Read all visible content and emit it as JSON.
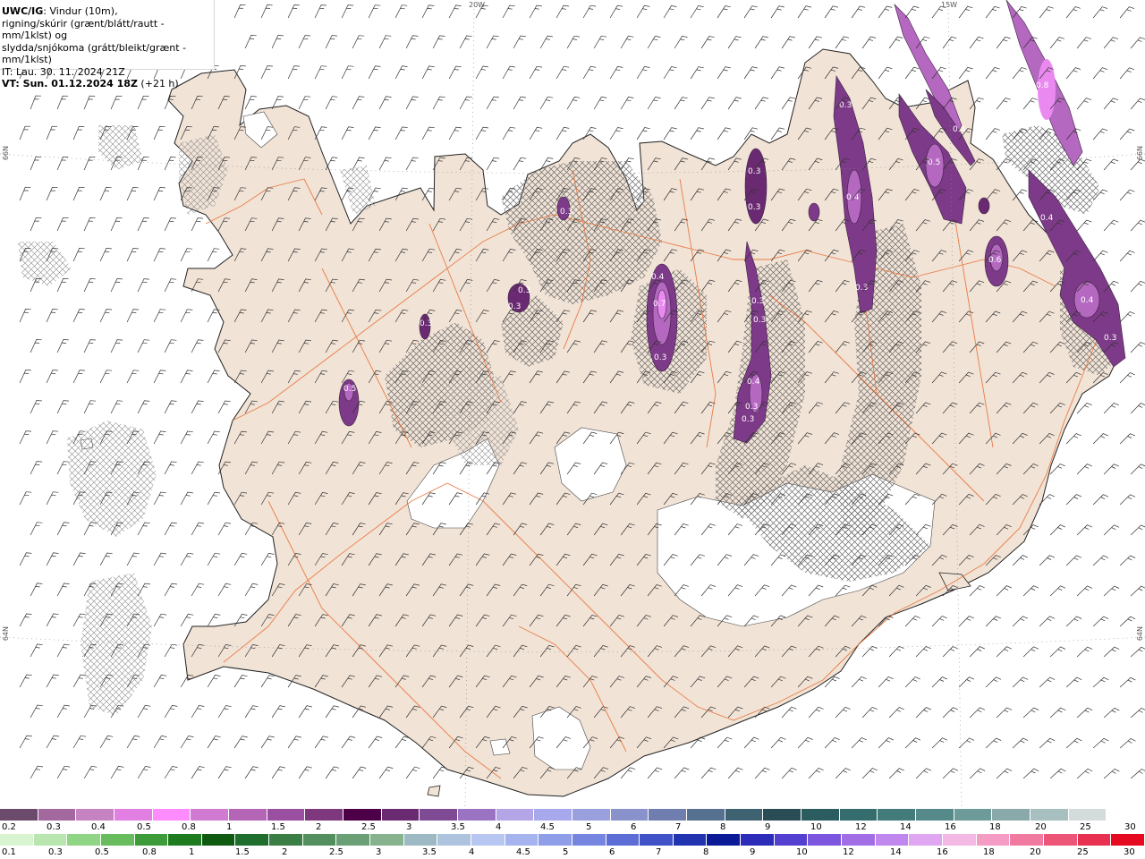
{
  "header": {
    "source": "UWC/IG",
    "line1_rest": ": Vindur (10m),",
    "line2": "rigning/skúrir (grænt/blátt/rautt - mm/1klst) og",
    "line3": "slydda/snjókoma (grátt/bleikt/grænt - mm/1klst)",
    "issue_time": "IT: Lau. 30. 11. 2024 21Z",
    "valid_prefix": "VT: Sun. 01.12.2024 18Z",
    "valid_suffix": " (+21 h)"
  },
  "grid_labels": {
    "lon_20w": "20W",
    "lon_15w": "15W",
    "lat_66n_left": "66N",
    "lat_66n_right": "66N",
    "lat_64n_left": "64N",
    "lat_64n_right": "64N"
  },
  "contour_labels": [
    "0.3",
    "0.3",
    "0.5",
    "0.3",
    "0.3",
    "0.3",
    "0.4",
    "0.7",
    "0.3",
    "0.3",
    "0.3",
    "0.3",
    "0.3",
    "0.4",
    "0.3",
    "0.3",
    "0.4",
    "0.3",
    "0.3",
    "0.5",
    "0.4",
    "0.8",
    "0.4",
    "0.6",
    "0.4",
    "0.3",
    "0.3",
    "0.3",
    "0.5"
  ],
  "legend_snow": {
    "colors": [
      "#6b4a6b",
      "#a3699f",
      "#c583c1",
      "#e27fe2",
      "#ff8cff",
      "#d07ad2",
      "#b565b5",
      "#9a4fa0",
      "#7d387e",
      "#4d0048",
      "#6a2a72",
      "#7e4a94",
      "#9a74c2",
      "#b4a6e6",
      "#a8a8ec",
      "#9aa0de",
      "#8a92cc",
      "#6f7eaf",
      "#567090",
      "#3f6272",
      "#2a4d55",
      "#2b5d60",
      "#356d6e",
      "#437b7b",
      "#568a8a",
      "#6e9a9a",
      "#8aa9aa",
      "#a7bfbe",
      "#d3dcda",
      "#ffffff"
    ],
    "ticks": [
      "0.2",
      "0.3",
      "0.4",
      "0.5",
      "0.8",
      "1",
      "1.5",
      "2",
      "2.5",
      "3",
      "3.5",
      "4",
      "4.5",
      "5",
      "6",
      "7",
      "8",
      "9",
      "10",
      "12",
      "14",
      "16",
      "18",
      "20",
      "25",
      "30"
    ]
  },
  "legend_rain": {
    "colors": [
      "#d8f4d0",
      "#b8e6ae",
      "#90d485",
      "#68bc5e",
      "#3d9c39",
      "#1f7b1f",
      "#0d5a10",
      "#1f6e2e",
      "#3a7e46",
      "#528e5e",
      "#6ba076",
      "#86b28e",
      "#9cb9c4",
      "#aec3dd",
      "#b8c6f2",
      "#a5b4ee",
      "#8f9ee8",
      "#7686e0",
      "#5d6dd6",
      "#4151c6",
      "#2233b0",
      "#0b1b98",
      "#2c2cb8",
      "#5440d0",
      "#7c56de",
      "#a26ee6",
      "#c088ee",
      "#e0a6f2",
      "#f4b8e4",
      "#f49cc4",
      "#f07aa0",
      "#ec5578",
      "#e83050",
      "#e60a20"
    ],
    "ticks": [
      "0.1",
      "0.3",
      "0.5",
      "0.8",
      "1",
      "1.5",
      "2",
      "2.5",
      "3",
      "3.5",
      "4",
      "4.5",
      "5",
      "6",
      "7",
      "8",
      "9",
      "10",
      "12",
      "14",
      "16",
      "18",
      "20",
      "25",
      "30"
    ]
  }
}
